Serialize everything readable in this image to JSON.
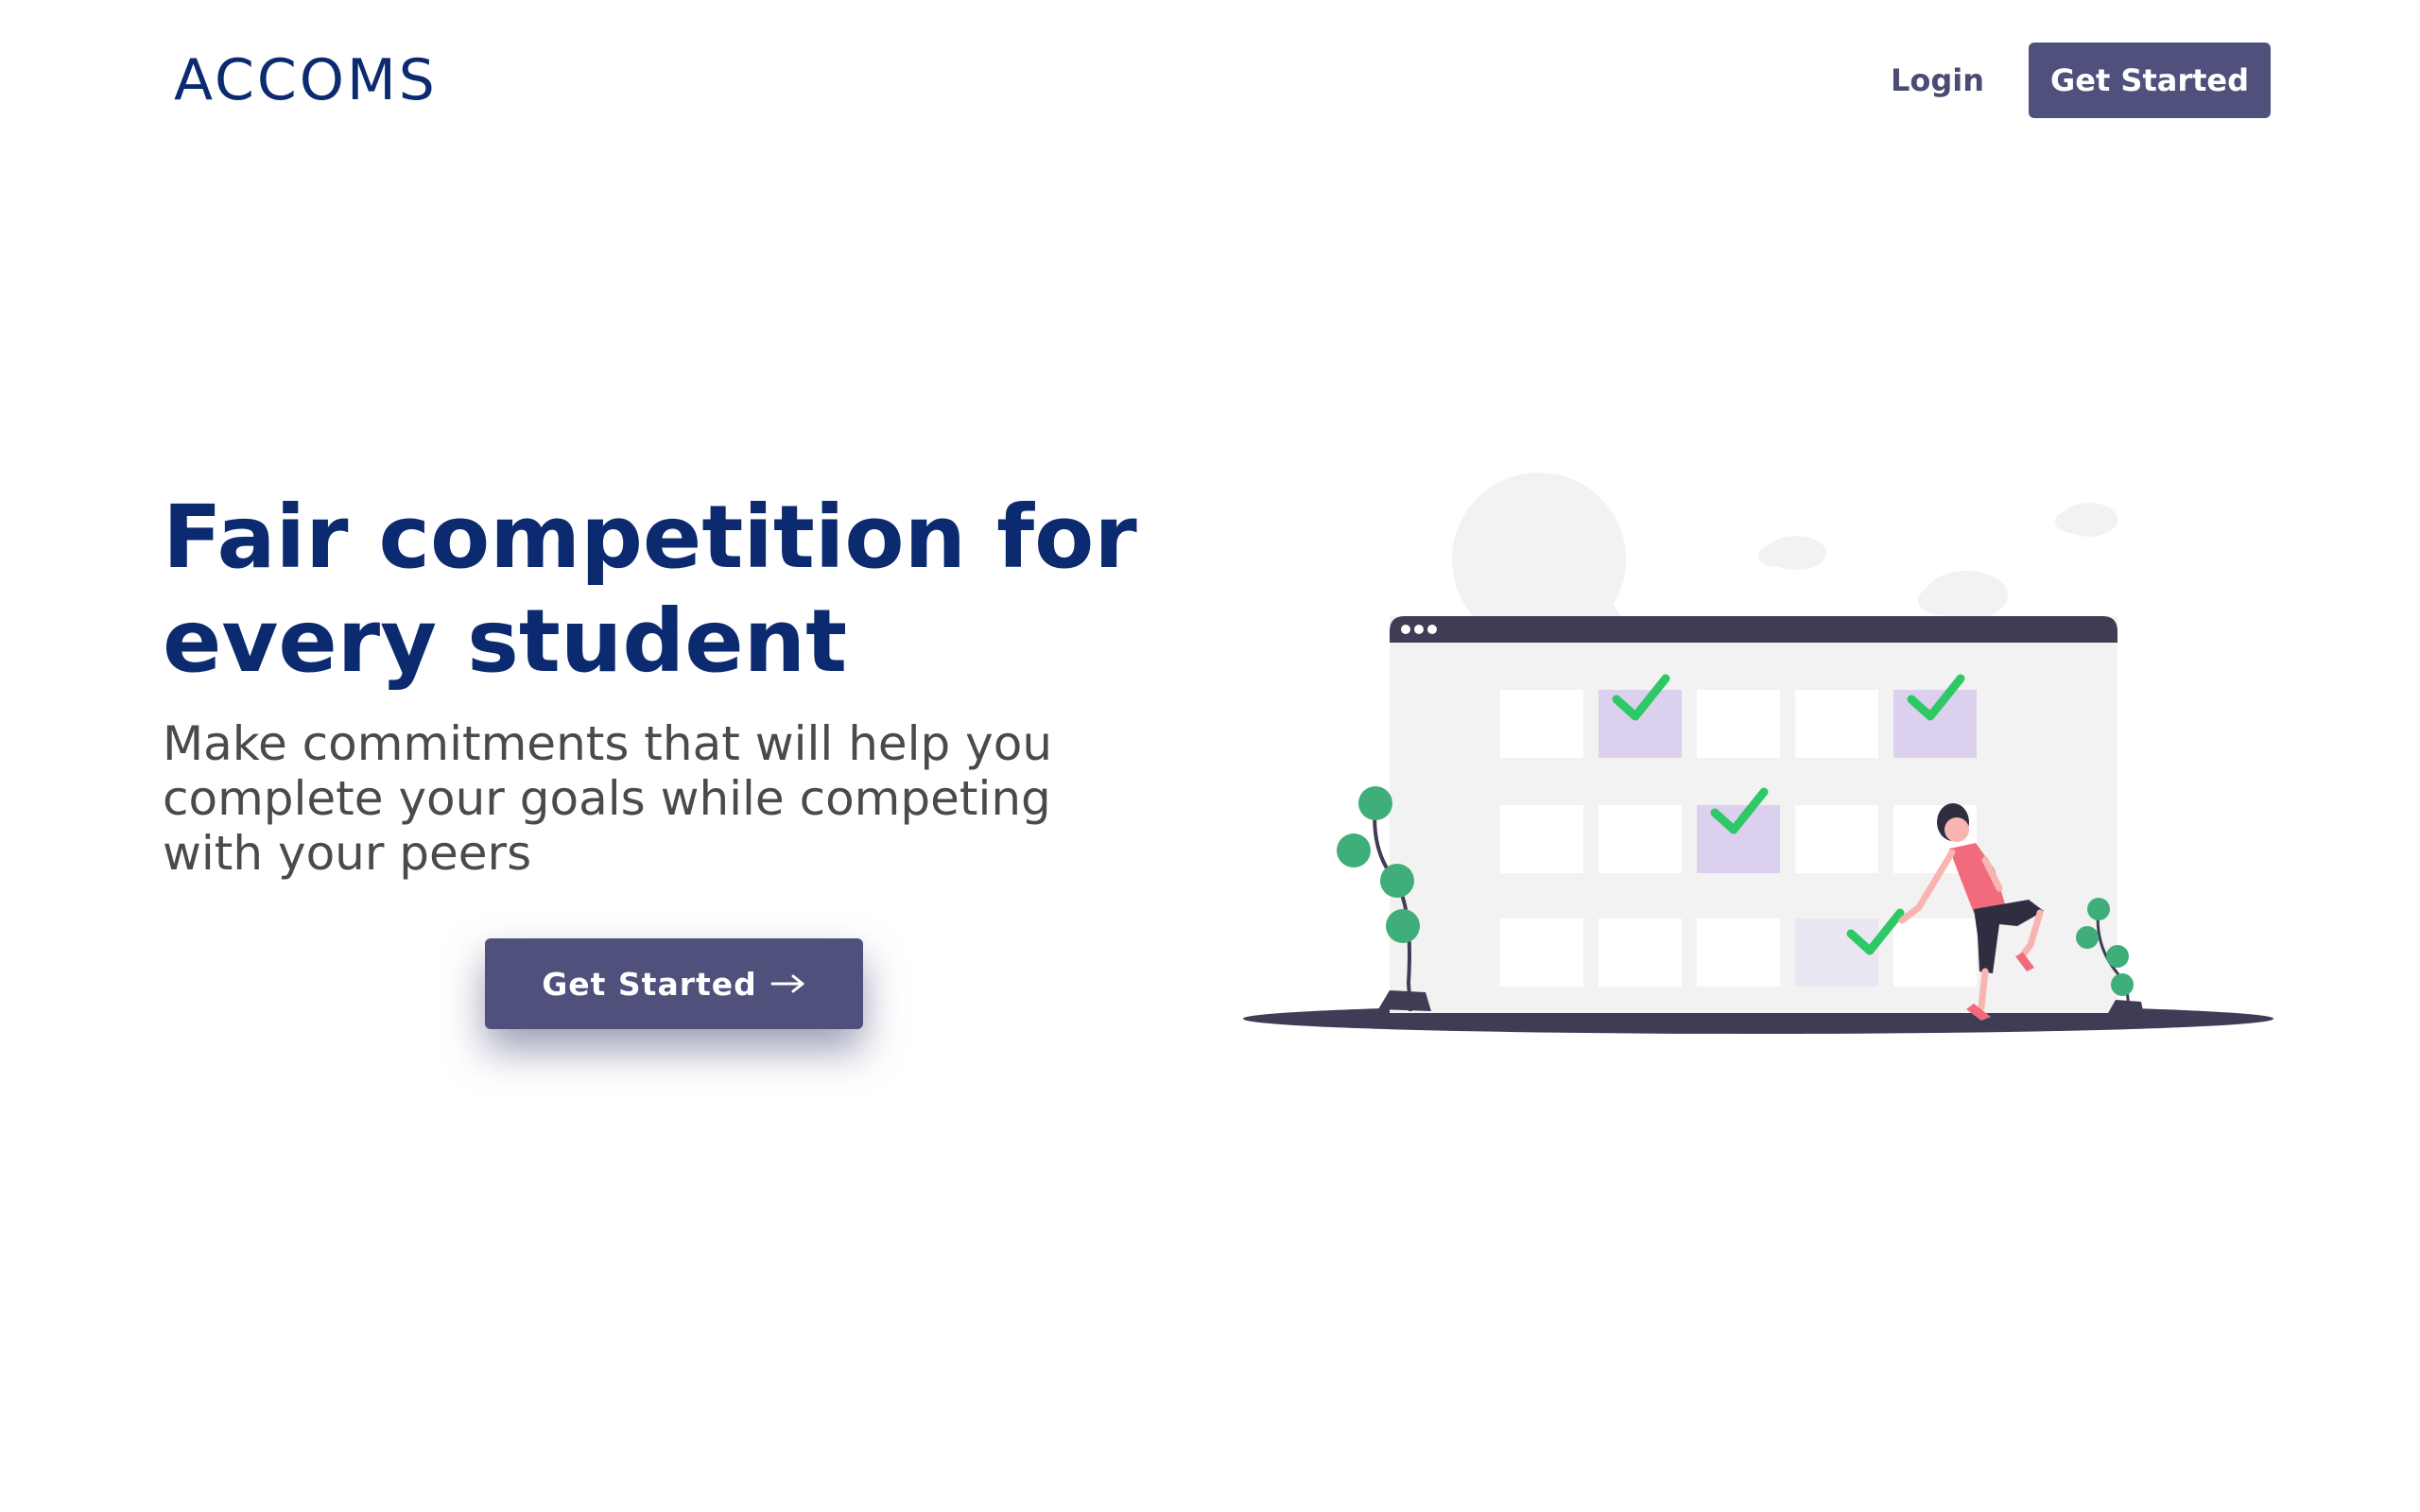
{
  "header": {
    "logo": "ACCOMS",
    "login_label": "Login",
    "cta_label": "Get Started"
  },
  "hero": {
    "title": "Fair competition for every student",
    "subtitle": "Make commitments that will help you complete your goals while competing with your peers",
    "cta_label": "Get Started",
    "cta_icon": "arrow-right-icon"
  },
  "illustration": {
    "icon": "calendar-checklist-illustration",
    "colors": {
      "window_bar": "#3f3d56",
      "window_body": "#f2f2f2",
      "cell": "#ffffff",
      "cell_highlight": "#dcd0ef",
      "check": "#2ec866",
      "person_shirt": "#f26b7c",
      "plant": "#3fae7a",
      "ground": "#3f3d56",
      "background_shapes": "#f2f2f2"
    }
  },
  "colors": {
    "brand": "#0b2a6f",
    "button": "#4f507b",
    "body_text": "#4a4a4a",
    "background": "#ffffff"
  }
}
